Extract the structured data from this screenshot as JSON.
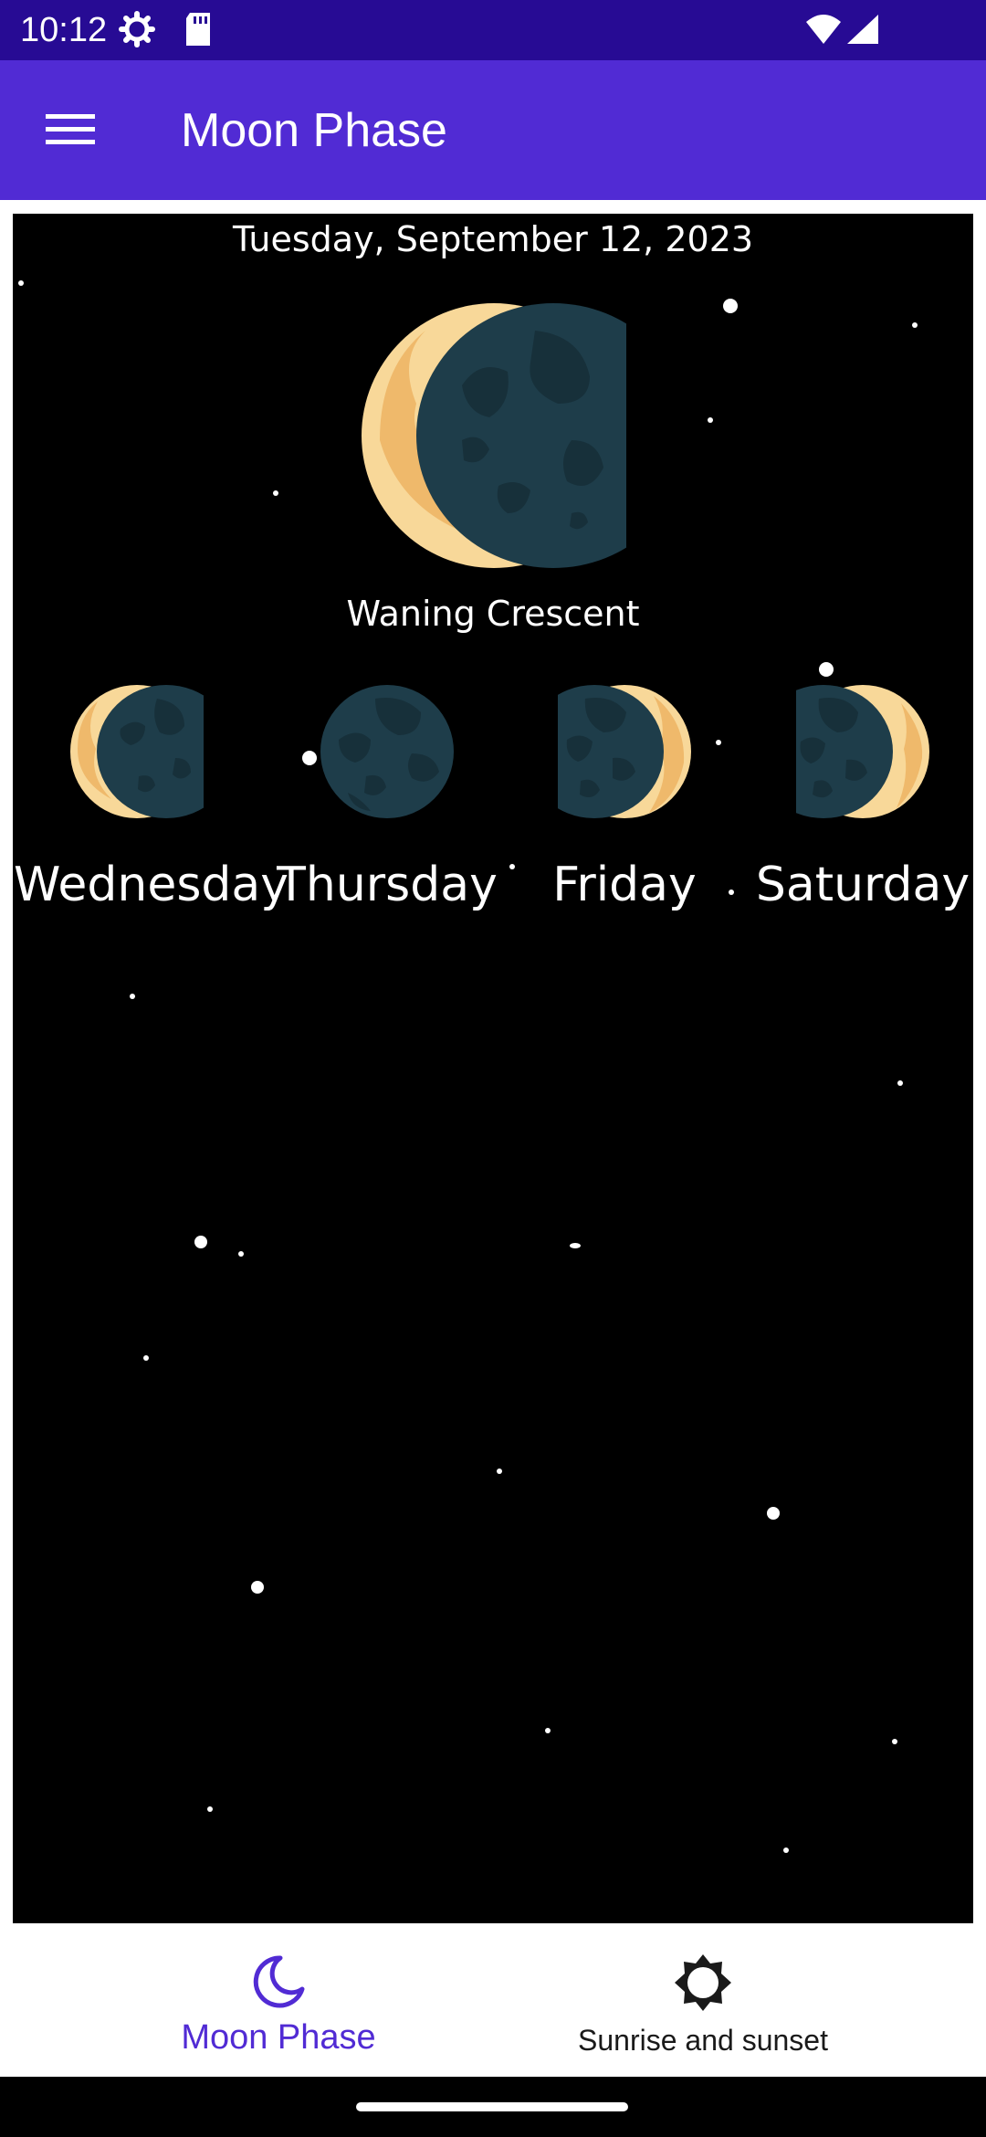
{
  "status_bar": {
    "time": "10:12",
    "icons": [
      "settings-gear-icon",
      "sd-card-icon",
      "wifi-icon",
      "cell-signal-icon"
    ]
  },
  "app_bar": {
    "title": "Moon Phase",
    "menu_icon": "hamburger-menu-icon",
    "background": "#512bd4"
  },
  "main": {
    "date": "Tuesday, September 12, 2023",
    "current_phase": "Waning Crescent",
    "forecast": [
      {
        "day": "Wednesday",
        "icon": "waning-crescent-moon-icon"
      },
      {
        "day": "Thursday",
        "icon": "new-moon-icon"
      },
      {
        "day": "Friday",
        "icon": "waxing-crescent-moon-icon"
      },
      {
        "day": "Saturday",
        "icon": "waxing-crescent-moon-icon"
      }
    ]
  },
  "bottom_nav": {
    "items": [
      {
        "label": "Moon Phase",
        "icon": "crescent-moon-icon",
        "selected": true
      },
      {
        "label": "Sunrise and sunset",
        "icon": "sun-icon",
        "selected": false
      }
    ],
    "accent_color": "#512bd4"
  },
  "colors": {
    "moon_light": "#f8d899",
    "moon_dark": "#1e3d4a",
    "sky": "#000000"
  }
}
